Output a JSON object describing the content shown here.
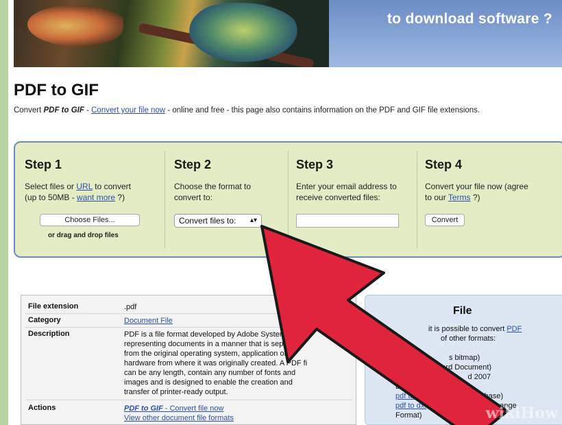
{
  "banner": {
    "text": "to download software ?"
  },
  "heading": {
    "title": "PDF to GIF"
  },
  "intro": {
    "prefix": "Convert ",
    "bold": "PDF to GIF",
    "dash": " - ",
    "link": "Convert your file now",
    "suffix": " - online and free - this page also contains information on the PDF and GIF file extensions."
  },
  "steps": [
    {
      "title": "Step 1",
      "line1_a": "Select files or ",
      "line1_link": "URL",
      "line1_b": " to convert",
      "line2_a": "(up to 50MB - ",
      "line2_link": "want more",
      "line2_b": " ?)",
      "button": "Choose Files...",
      "note": "or drag and drop files"
    },
    {
      "title": "Step 2",
      "line1": "Choose the format to",
      "line2": "convert to:",
      "select_value": "Convert files to:"
    },
    {
      "title": "Step 3",
      "line1": "Enter your email address to",
      "line2": "receive converted files:"
    },
    {
      "title": "Step 4",
      "line1": "Convert your file now (agree",
      "line2_a": "to our ",
      "line2_link": "Terms",
      "line2_b": " ?)",
      "button": "Convert"
    }
  ],
  "info": {
    "rows": [
      {
        "key": "File extension",
        "value": ".pdf"
      },
      {
        "key": "Category",
        "value_link": "Document File"
      },
      {
        "key": "Description",
        "lines": [
          "PDF is a file format developed by Adobe Systems fo",
          "representing documents in a manner that is separate",
          "from the original operating system, application or",
          "hardware from where it was originally created. A PDF fi",
          "can be any length, contain any number of fonts and",
          "images and is designed to enable the creation and",
          "transfer of printer-ready output."
        ]
      },
      {
        "key": "Actions",
        "action1_bold": "PDF to GIF",
        "action1_rest": " - Convert file now",
        "action2": "View other document file formats"
      }
    ]
  },
  "side": {
    "heading": "File",
    "line1_a": "it is possible to convert ",
    "line1_link": "PDF",
    "line2": "of other formats:",
    "items": [
      {
        "text": "s bitmap)"
      },
      {
        "link": "pdf",
        "text": "ord Document)"
      },
      {
        "link": "pdf to",
        "text": "d 2007"
      },
      {
        "text": "Documen"
      },
      {
        "link": "pdf to dwg",
        "text": " (A        ing Database)"
      },
      {
        "link": "pdf to dxf",
        "text": " (Auto      wing Interchange"
      },
      {
        "text": "Format)"
      }
    ]
  },
  "watermark": {
    "a": "wiki",
    "b": "How"
  },
  "colors": {
    "arrow": "#e0243c",
    "panel": "#e3ecc4",
    "panel_border": "#6a8bbf",
    "link": "#2a4fb0",
    "background": "#b8d3a0"
  }
}
